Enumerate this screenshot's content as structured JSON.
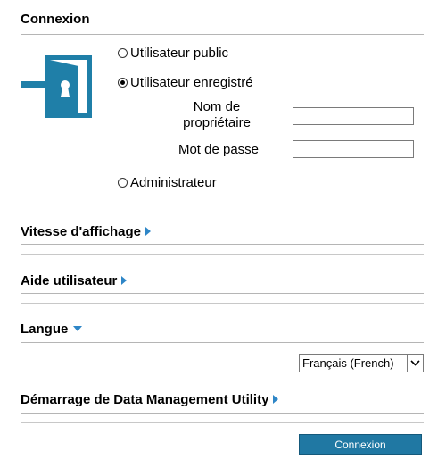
{
  "login": {
    "title": "Connexion",
    "options": {
      "public": "Utilisateur public",
      "registered": "Utilisateur enregistré",
      "admin": "Administrateur"
    },
    "selected_option": "registered",
    "owner_name_label_line1": "Nom de",
    "owner_name_label_line2": "propriétaire",
    "owner_name_value": "",
    "password_label": "Mot de passe",
    "password_value": ""
  },
  "sections": {
    "display_speed": "Vitesse d'affichage",
    "user_help": "Aide utilisateur",
    "language": "Langue",
    "data_management": "Démarrage de Data Management Utility"
  },
  "language": {
    "selected": "Français (French)"
  },
  "button": {
    "login_label": "Connexion"
  },
  "colors": {
    "icon_teal": "#1f7fa8",
    "arrow_blue": "#2e86c7",
    "button_bg": "#2078a3"
  },
  "icons": {
    "login_icon": "door-enter-icon"
  }
}
